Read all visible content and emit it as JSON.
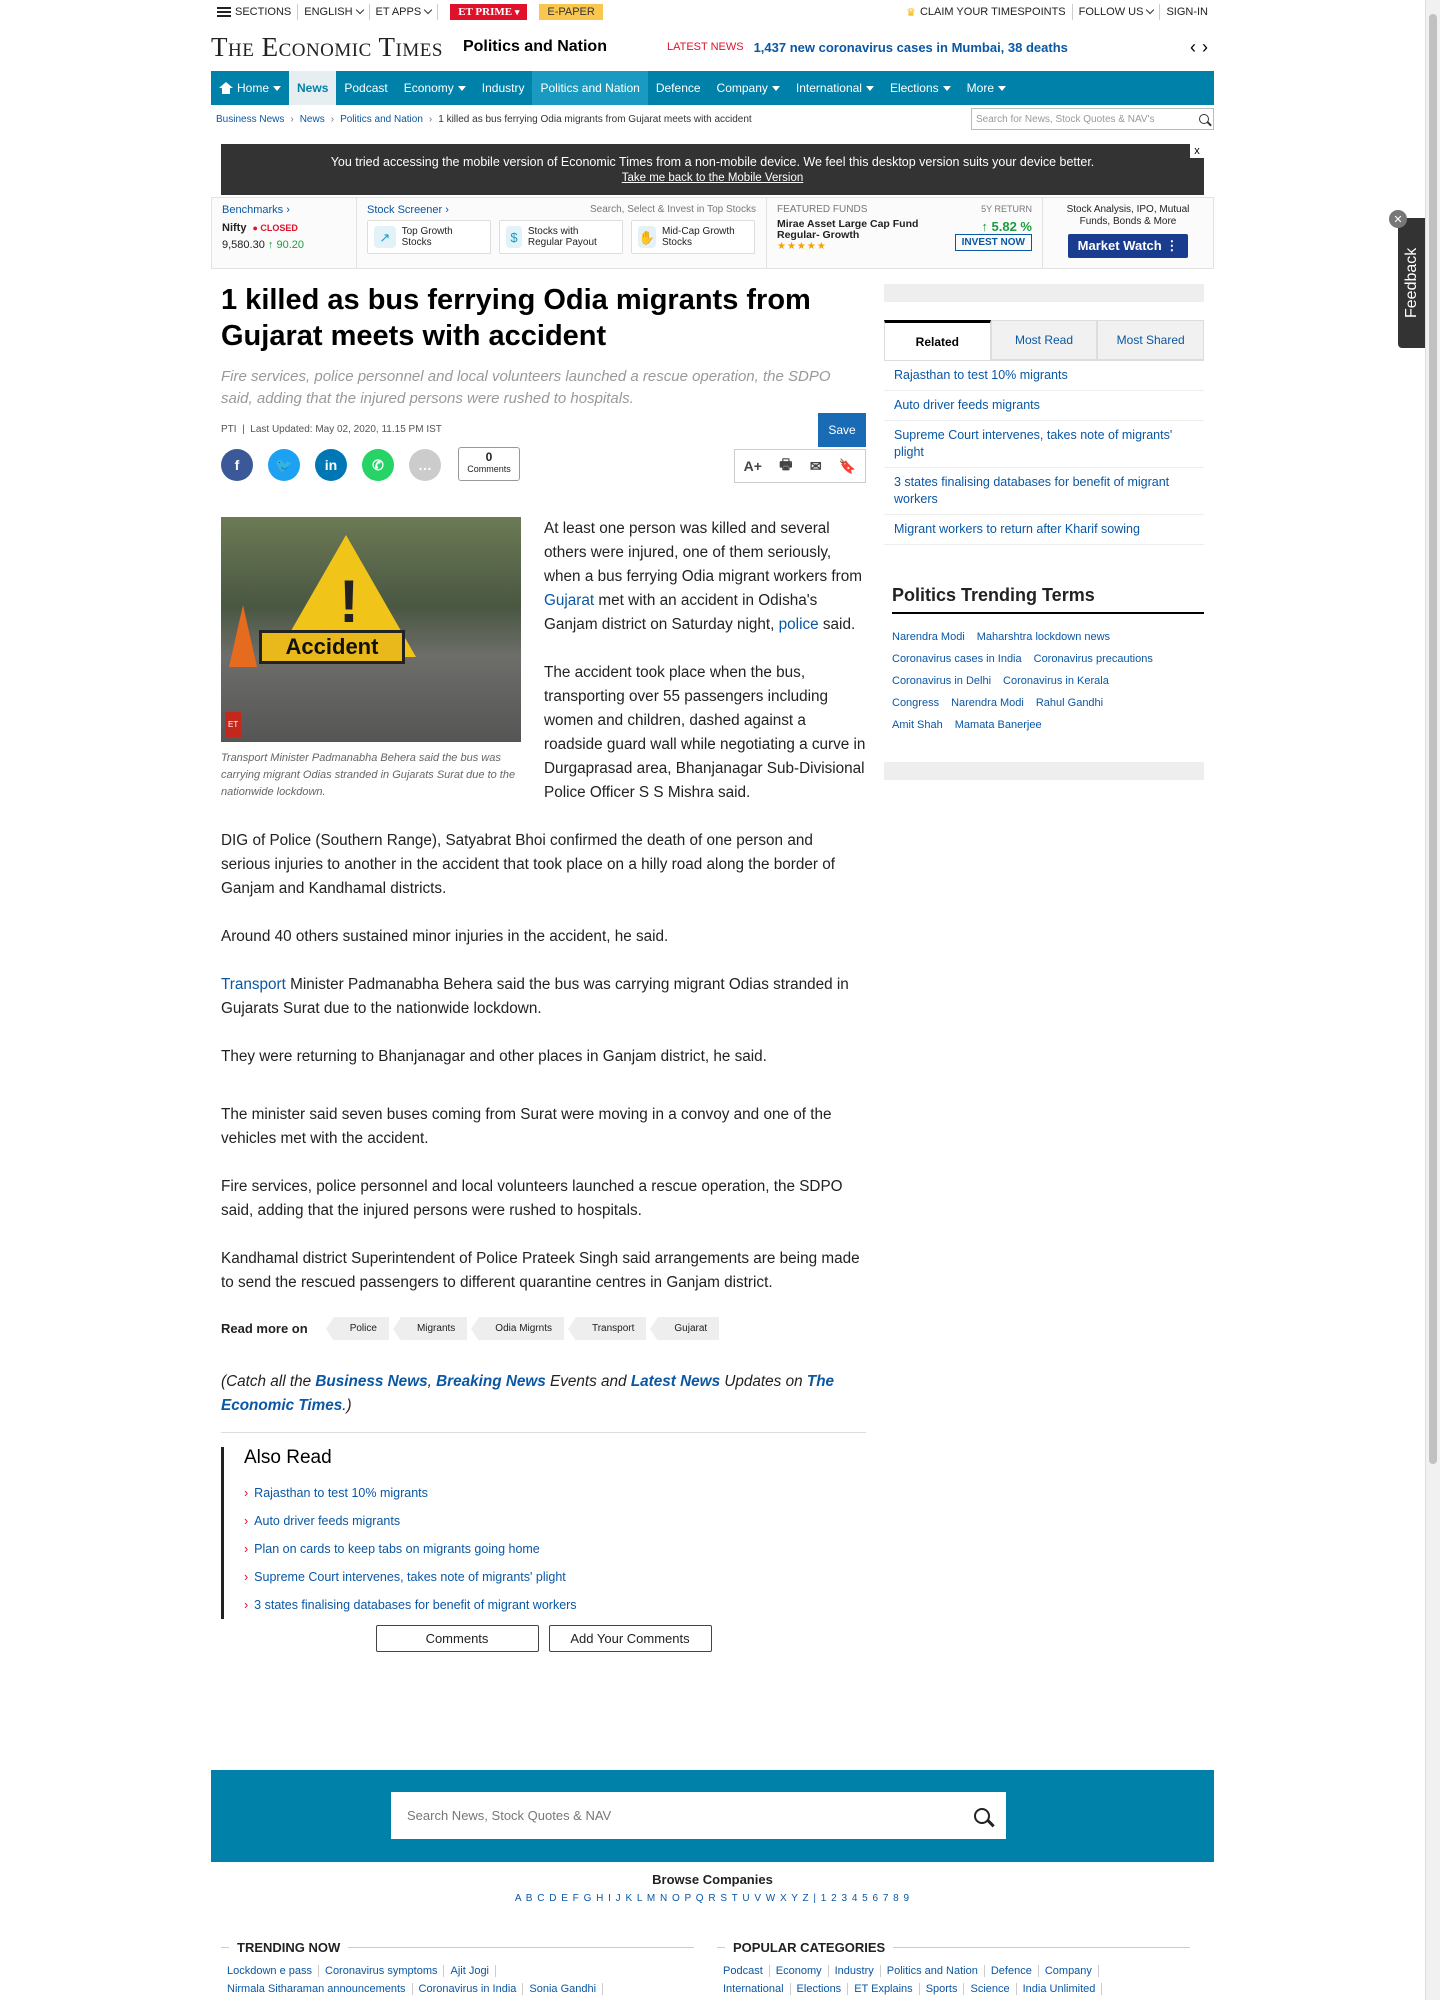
{
  "topbar": {
    "sections": "SECTIONS",
    "language": "ENGLISH",
    "et_apps": "ET APPS",
    "et_prime": "ET PRIME",
    "epaper": "E-PAPER",
    "claim": "CLAIM YOUR TIMESPOINTS",
    "follow": "FOLLOW US",
    "signin": "SIGN-IN"
  },
  "masthead": {
    "logo": "The Economic Times",
    "section": "Politics and Nation",
    "latest_label": "LATEST NEWS",
    "latest_text": "1,437 new coronavirus cases in Mumbai, 38 deaths"
  },
  "nav": {
    "items": [
      "Home",
      "News",
      "Podcast",
      "Economy",
      "Industry",
      "Politics and Nation",
      "Defence",
      "Company",
      "International",
      "Elections",
      "More"
    ]
  },
  "breadcrumb": {
    "items": [
      "Business News",
      "News",
      "Politics and Nation",
      "1 killed as bus ferrying Odia migrants from Gujarat meets with accident"
    ],
    "search_placeholder": "Search for News, Stock Quotes & NAV's"
  },
  "notice": {
    "text": "You tried accessing the mobile version of Economic Times from a non-mobile device. We feel this desktop version suits your device better.",
    "link": "Take me back to the Mobile Version",
    "close": "x"
  },
  "market": {
    "benchmarks": "Benchmarks",
    "index_name": "Nifty",
    "status": "CLOSED",
    "value": "9,580.30",
    "change": "90.20",
    "screener": "Stock Screener",
    "screener_hint": "Search, Select & Invest in Top Stocks",
    "screens": [
      "Top Growth Stocks",
      "Stocks with Regular Payout",
      "Mid-Cap Growth Stocks"
    ],
    "featured": "FEATURED FUNDS",
    "return_label": "5Y RETURN",
    "fund_name": "Mirae Asset Large Cap Fund Regular- Growth",
    "fund_return": "5.82 %",
    "fund_rating": 5,
    "invest": "INVEST NOW",
    "mw_text": "Stock Analysis, IPO, Mutual Funds, Bonds & More",
    "mw_button": "Market Watch"
  },
  "article": {
    "title": "1 killed as bus ferrying Odia migrants from Gujarat meets with accident",
    "synopsis": "Fire services, police personnel and local volunteers launched a rescue operation, the SDPO said, adding that the injured persons were rushed to hospitals.",
    "source": "PTI",
    "updated": "Last Updated: May 02, 2020, 11.15 PM IST",
    "comments_count": "0",
    "comments_label": "Comments",
    "save": "Save",
    "font_size": "A+",
    "image_sign": "Accident",
    "image_mark": "ET",
    "caption": "Transport Minister Padmanabha Behera said the bus was carrying migrant Odias stranded in Gujarats Surat due to the nationwide lockdown.",
    "p1_a": "At least one person was killed and several others were injured, one of them seriously, when a bus ferrying Odia migrant workers from ",
    "p1_link1": "Gujarat",
    "p1_b": " met with an accident in Odisha's Ganjam district on Saturday night, ",
    "p1_link2": "police",
    "p1_c": " said.",
    "p2": "The accident took place when the bus, transporting over 55 passengers including women and children, dashed against a roadside guard wall while negotiating a curve in Durgaprasad area, Bhanjanagar Sub-Divisional Police Officer S S Mishra said.",
    "p3": "DIG of Police (Southern Range), Satyabrat Bhoi confirmed the death of one person and serious injuries to another in the accident that took place on a hilly road along the border of Ganjam and Kandhamal districts.",
    "p4": "Around 40 others sustained minor injuries in the accident, he said.",
    "p5_link": "Transport",
    "p5": " Minister Padmanabha Behera said the bus was carrying migrant Odias stranded in Gujarats Surat due to the nationwide lockdown.",
    "p6": "They were returning to Bhanjanagar and other places in Ganjam district, he said.",
    "p7": "The minister said seven buses coming from Surat were moving in a convoy and one of the vehicles met with the accident.",
    "p8": "Fire services, police personnel and local volunteers launched a rescue operation, the SDPO said, adding that the injured persons were rushed to hospitals.",
    "p9": "Kandhamal district Superintendent of Police Prateek Singh said arrangements are being made to send the rescued passengers to different quarantine centres in Ganjam district.",
    "read_more_label": "Read more on",
    "tags": [
      "Police",
      "Migrants",
      "Odia Migrnts",
      "Transport",
      "Gujarat"
    ],
    "catch_a": "(Catch all the ",
    "catch_l1": "Business News",
    "catch_sep": ", ",
    "catch_l2": "Breaking News",
    "catch_b": " Events and ",
    "catch_l3": "Latest News",
    "catch_c": " Updates on ",
    "catch_l4": "The Economic Times",
    "catch_d": ".)",
    "also_read_title": "Also Read",
    "also_read": [
      "Rajasthan to test 10% migrants",
      "Auto driver feeds migrants",
      "Plan on cards to keep tabs on migrants going home",
      "Supreme Court intervenes, takes note of migrants' plight",
      "3 states finalising databases for benefit of migrant workers"
    ],
    "btn_comments": "Comments",
    "btn_add": "Add Your Comments"
  },
  "sidebar": {
    "tabs": [
      "Related",
      "Most Read",
      "Most Shared"
    ],
    "related": [
      "Rajasthan to test 10% migrants",
      "Auto driver feeds migrants",
      "Supreme Court intervenes, takes note of migrants' plight",
      "3 states finalising databases for benefit of migrant workers",
      "Migrant workers to return after Kharif sowing"
    ],
    "trending_title": "Politics Trending Terms",
    "terms": [
      "Narendra Modi",
      "Maharshtra lockdown news",
      "Coronavirus cases in India",
      "Coronavirus precautions",
      "Coronavirus in Delhi",
      "Coronavirus in Kerala",
      "Congress",
      "Narendra Modi",
      "Rahul Gandhi",
      "Amit Shah",
      "Mamata Banerjee"
    ],
    "feedback": "Feedback"
  },
  "footer": {
    "search_placeholder": "Search News, Stock Quotes & NAV",
    "browse": "Browse Companies",
    "letters": "A B C D E F G H I J K L M N O P Q R S T U V W X Y Z | 1 2 3 4 5 6 7 8 9",
    "trending_title": "TRENDING NOW",
    "trending_row1": [
      "Lockdown e pass",
      "Coronavirus symptoms",
      "Ajit Jogi"
    ],
    "trending_row2": [
      "Nirmala Sitharaman announcements",
      "Coronavirus in India",
      "Sonia Gandhi"
    ],
    "popular_title": "POPULAR CATEGORIES",
    "popular_row1": [
      "Podcast",
      "Economy",
      "Industry",
      "Politics and Nation",
      "Defence",
      "Company"
    ],
    "popular_row2": [
      "International",
      "Elections",
      "ET Explains",
      "Sports",
      "Science",
      "India Unlimited"
    ]
  }
}
